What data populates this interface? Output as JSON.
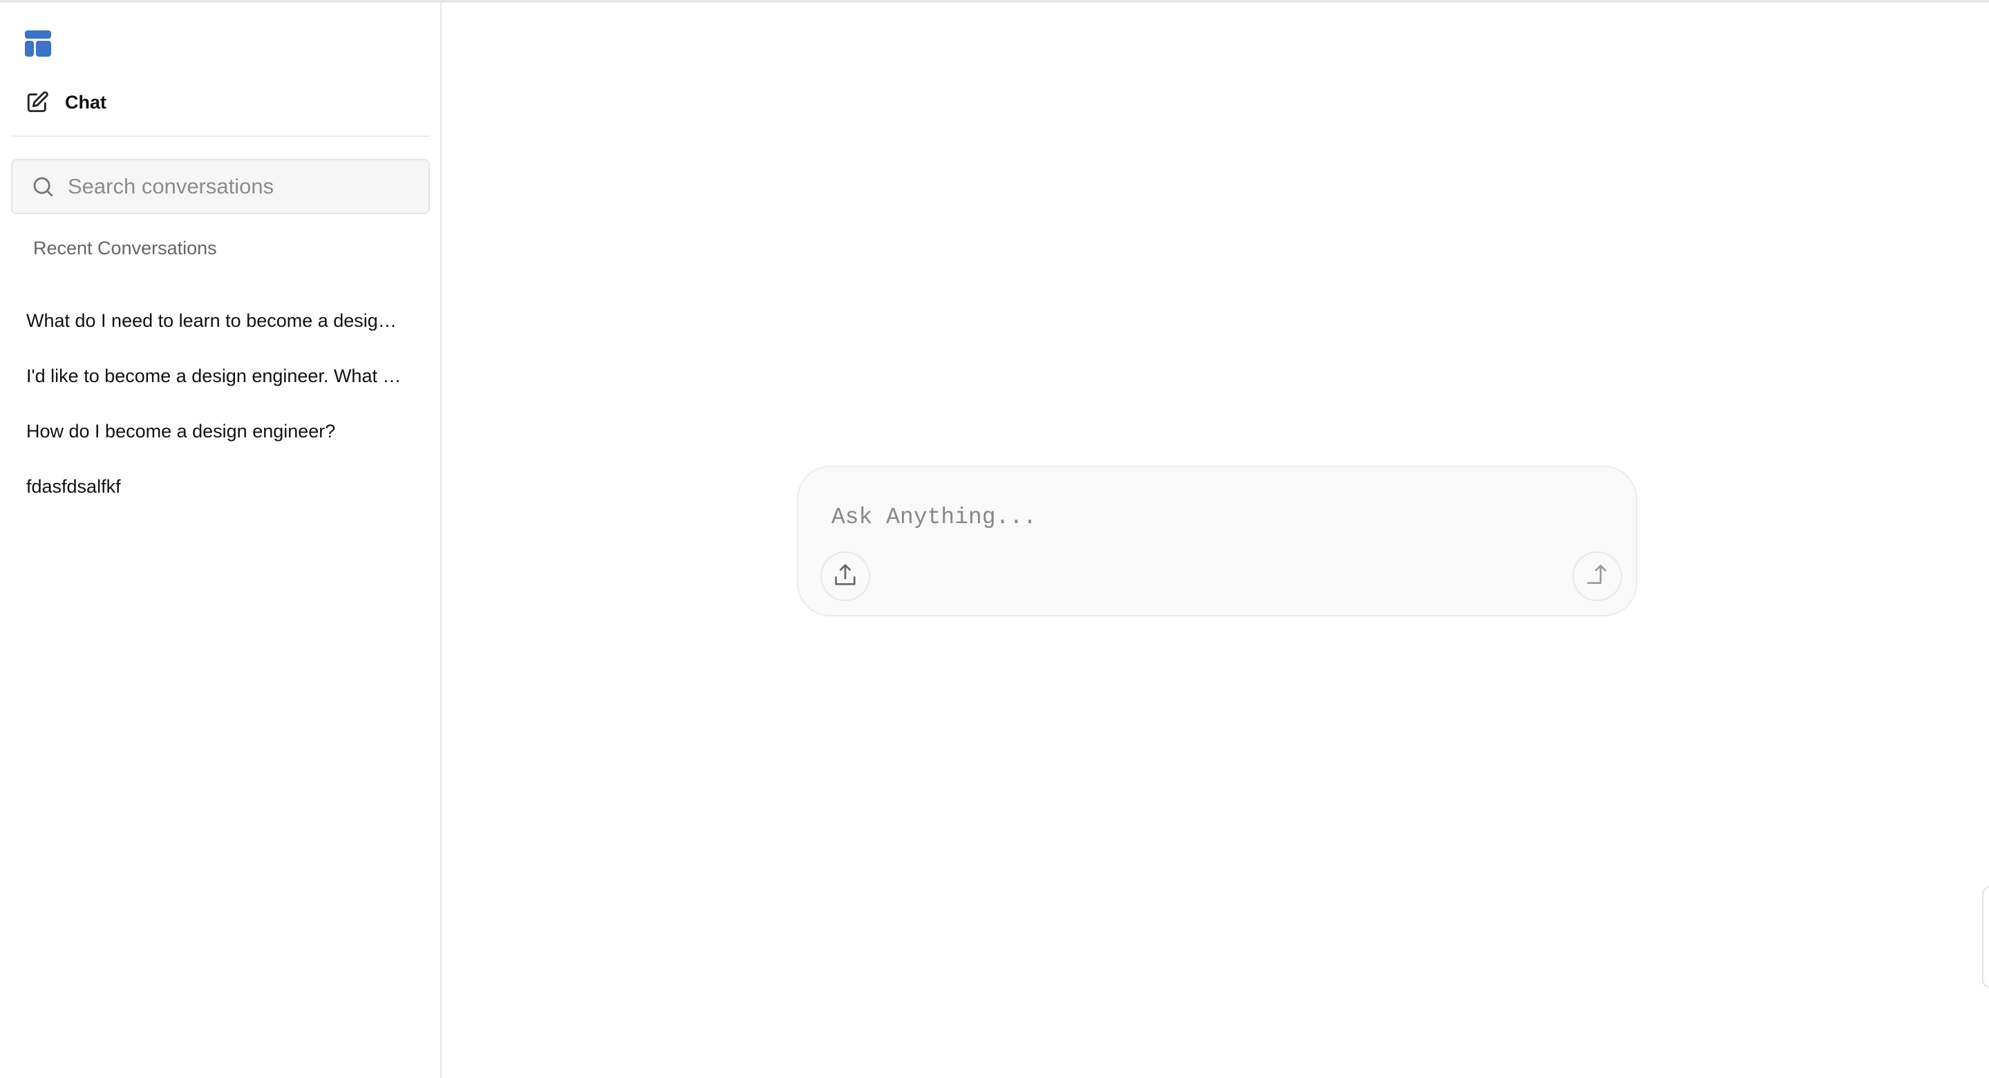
{
  "sidebar": {
    "new_chat_label": "Chat",
    "search": {
      "placeholder": "Search conversations",
      "value": ""
    },
    "section_heading": "Recent Conversations",
    "conversations": [
      {
        "title": "What do I need to learn to become a design engineer?",
        "display": "What do I need to learn to become a desig…"
      },
      {
        "title": "I'd like to become a design engineer. What …",
        "display": "I'd like to become a design engineer. What …"
      },
      {
        "title": "How do I become a design engineer?",
        "display": "How do I become a design engineer?"
      },
      {
        "title": "fdasfdsalfkf",
        "display": "fdasfdsalfkf"
      }
    ]
  },
  "composer": {
    "placeholder": "Ask Anything...",
    "value": ""
  },
  "icons": {
    "logo": "dashboard-grid-icon",
    "new_chat": "edit-square-icon",
    "search": "search-icon",
    "upload": "upload-icon",
    "send": "send-arrow-icon"
  },
  "colors": {
    "accent": "#3a73c9",
    "sidebar_border": "#e8e8e8",
    "composer_bg": "#f9f9f9"
  }
}
